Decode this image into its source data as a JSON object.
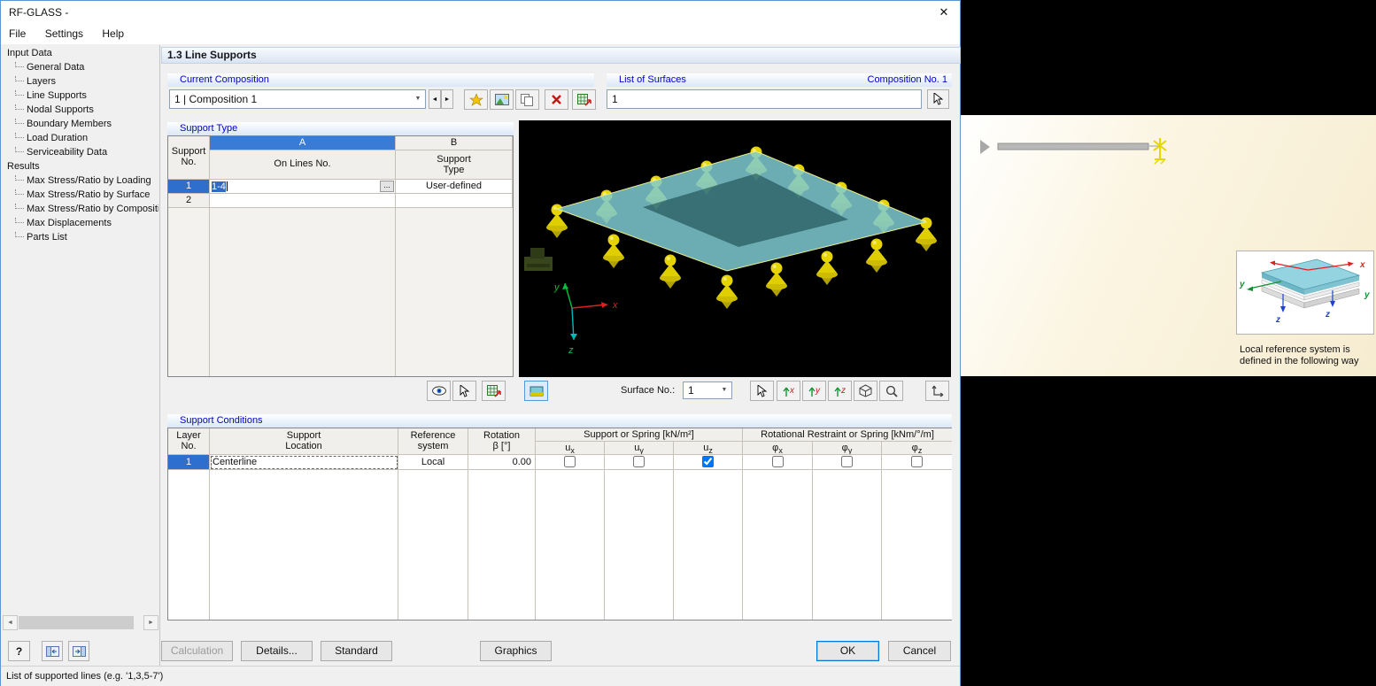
{
  "window": {
    "title": "RF-GLASS -",
    "close": "✕"
  },
  "menu": {
    "file": "File",
    "settings": "Settings",
    "help": "Help"
  },
  "sidebar": {
    "input_root": "Input Data",
    "input_items": [
      "General Data",
      "Layers",
      "Line Supports",
      "Nodal Supports",
      "Boundary Members",
      "Load Duration",
      "Serviceability Data"
    ],
    "results_root": "Results",
    "results_items": [
      "Max Stress/Ratio by Loading",
      "Max Stress/Ratio by Surface",
      "Max Stress/Ratio by Compositio",
      "Max Displacements",
      "Parts List"
    ]
  },
  "header": {
    "title": "1.3 Line Supports"
  },
  "composition": {
    "label": "Current Composition",
    "value": "1 | Composition 1"
  },
  "surfaces": {
    "label": "List of Surfaces",
    "composition_no": "Composition No. 1",
    "value": "1"
  },
  "support_type": {
    "label": "Support Type",
    "col_a": "A",
    "col_b": "B",
    "header_no": [
      "Support",
      "No."
    ],
    "header_lines": "On Lines No.",
    "header_type": [
      "Support",
      "Type"
    ],
    "row1": {
      "no": "1",
      "lines": "1-4",
      "type": "User-defined"
    },
    "row2": {
      "no": "2"
    }
  },
  "viewport": {
    "surface_label": "Surface No.:",
    "surface_value": "1",
    "axes": {
      "x": "x",
      "y": "y",
      "z": "z"
    }
  },
  "support_conditions": {
    "label": "Support Conditions",
    "header_layer": [
      "Layer",
      "No."
    ],
    "header_location": [
      "Support",
      "Location"
    ],
    "header_reference": [
      "Reference",
      "system"
    ],
    "header_rotation": [
      "Rotation",
      "β [°]"
    ],
    "group_support": "Support or Spring [kN/m²]",
    "group_rotational": "Rotational Restraint or Spring [kNm/°/m]",
    "dofs": [
      {
        "base": "u",
        "sub": "x"
      },
      {
        "base": "u",
        "sub": "y"
      },
      {
        "base": "u",
        "sub": "z"
      },
      {
        "base": "φ",
        "sub": "x"
      },
      {
        "base": "φ",
        "sub": "y"
      },
      {
        "base": "φ",
        "sub": "z"
      }
    ],
    "row": {
      "layer": "1",
      "location": "Centerline",
      "reference": "Local",
      "rotation": "0.00",
      "ux": false,
      "uy": false,
      "uz": true,
      "phix": false,
      "phiy": false,
      "phiz": false
    }
  },
  "footer": {
    "help": "?",
    "calculation": "Calculation",
    "details": "Details...",
    "standard": "Standard",
    "graphics": "Graphics",
    "ok": "OK",
    "cancel": "Cancel"
  },
  "statusbar": {
    "text": "List of supported lines (e.g. '1,3,5-7')"
  },
  "tooltip": {
    "caption1": "Local reference system is",
    "caption2": "defined in the following way",
    "axes": {
      "x": "x",
      "y": "y",
      "z": "z"
    }
  },
  "icons": {
    "dropdown": "▼",
    "prev": "◄",
    "next": "►",
    "ellipsis": "...",
    "scroll_left": "◄",
    "scroll_right": "►"
  }
}
